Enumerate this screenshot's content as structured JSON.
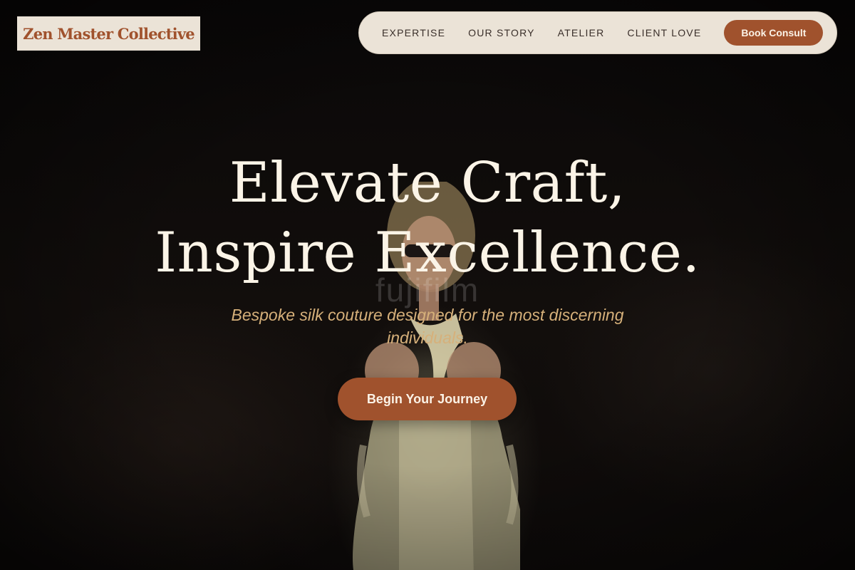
{
  "brand": {
    "name": "Zen Master Collective",
    "accent_color": "#a0522d",
    "cream_color": "#ebe3d7"
  },
  "nav": {
    "links": [
      "EXPERTISE",
      "OUR STORY",
      "ATELIER",
      "CLIENT LOVE"
    ],
    "cta_label": "Book Consult"
  },
  "hero": {
    "title_line1": "Elevate Craft,",
    "title_line2": "Inspire Excellence.",
    "subtitle": "Bespoke silk couture designed for the most discerning individuals.",
    "cta_label": "Begin Your Journey",
    "watermark": "fujifilm",
    "background_image": "runway model in silk dress with audience"
  }
}
